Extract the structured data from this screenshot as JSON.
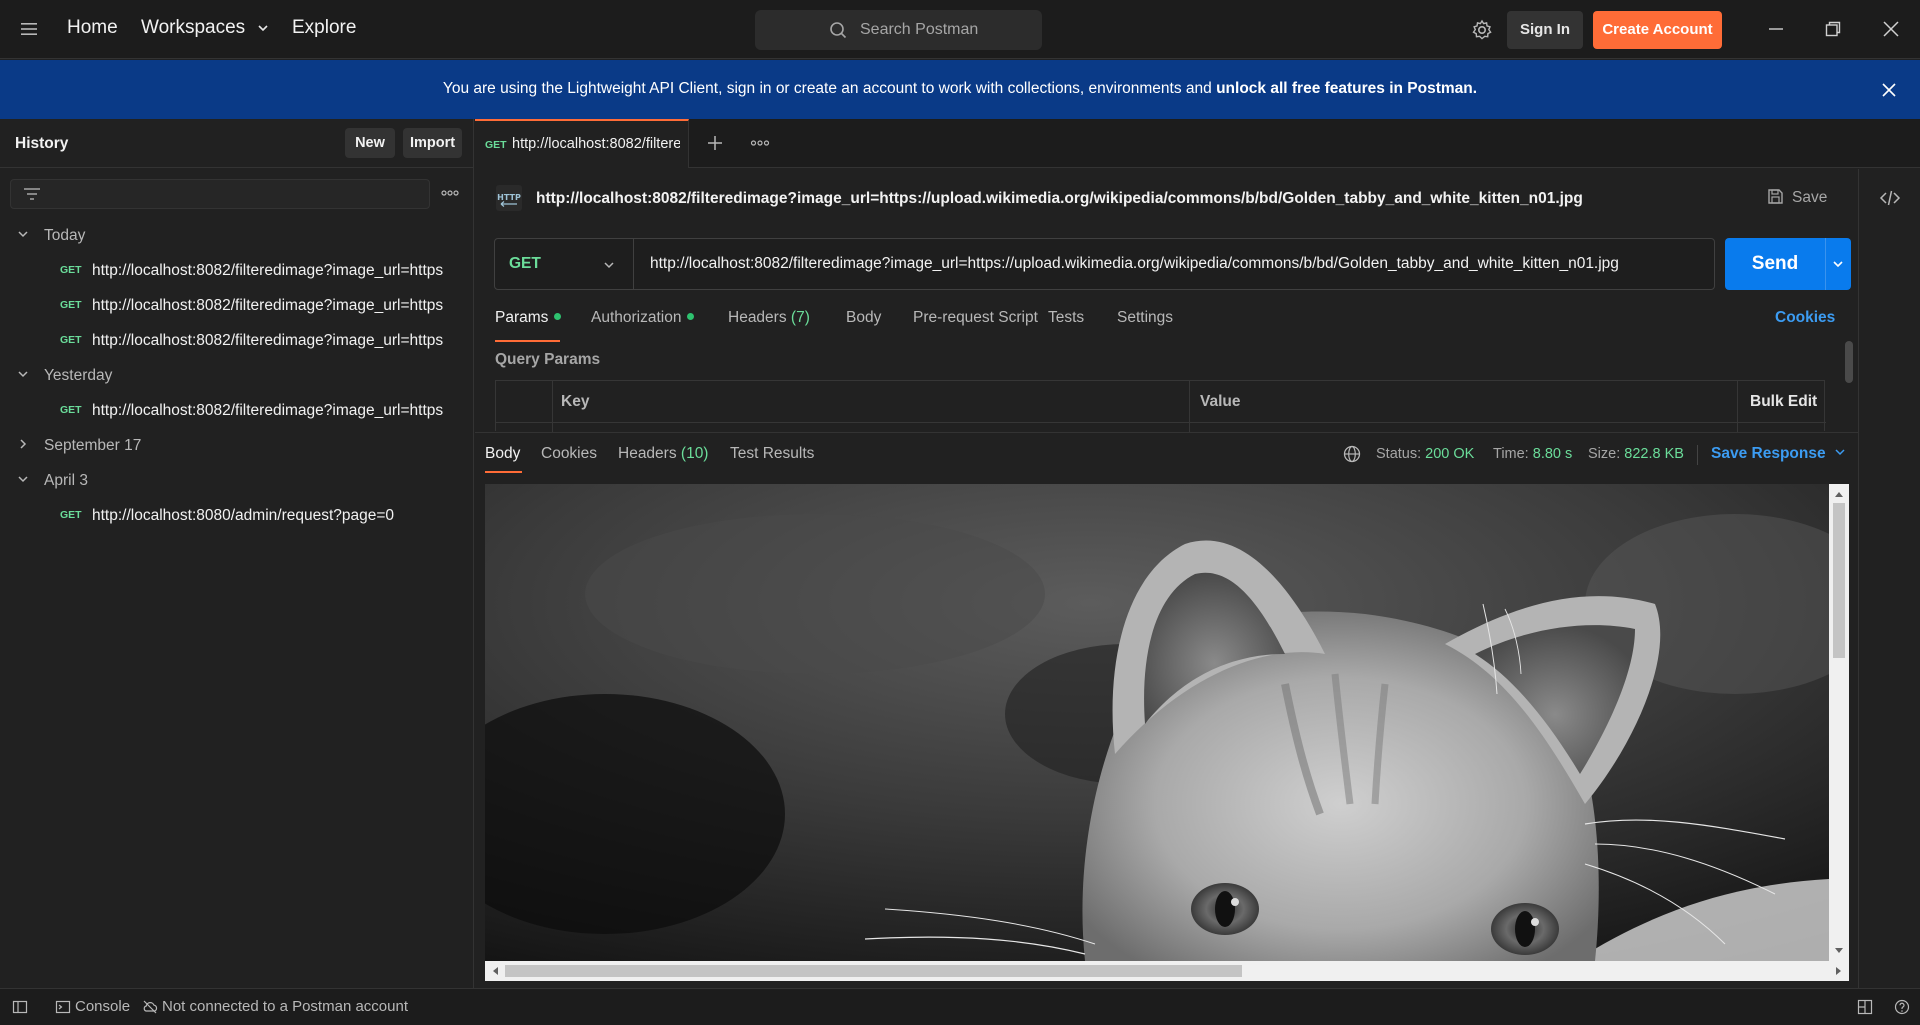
{
  "topbar": {
    "nav": {
      "home": "Home",
      "workspaces": "Workspaces",
      "explore": "Explore"
    },
    "search_placeholder": "Search Postman",
    "sign_in": "Sign In",
    "create_account": "Create Account"
  },
  "banner": {
    "text": "You are using the Lightweight API Client, sign in or create an account to work with collections, environments and ",
    "bold": "unlock all free features in Postman."
  },
  "sidebar": {
    "title": "History",
    "new_label": "New",
    "import_label": "Import",
    "groups": [
      {
        "label": "Today",
        "expanded": true,
        "items": [
          {
            "method": "GET",
            "url": "http://localhost:8082/filteredimage?image_url=https"
          },
          {
            "method": "GET",
            "url": "http://localhost:8082/filteredimage?image_url=https"
          },
          {
            "method": "GET",
            "url": "http://localhost:8082/filteredimage?image_url=https"
          }
        ]
      },
      {
        "label": "Yesterday",
        "expanded": true,
        "items": [
          {
            "method": "GET",
            "url": "http://localhost:8082/filteredimage?image_url=https"
          }
        ]
      },
      {
        "label": "September 17",
        "expanded": false,
        "items": []
      },
      {
        "label": "April 3",
        "expanded": true,
        "items": [
          {
            "method": "GET",
            "url": "http://localhost:8080/admin/request?page=0"
          }
        ]
      }
    ]
  },
  "tab": {
    "method": "GET",
    "url": "http://localhost:8082/filteredimage?image_url=https"
  },
  "request": {
    "title": "http://localhost:8082/filteredimage?image_url=https://upload.wikimedia.org/wikipedia/commons/b/bd/Golden_tabby_and_white_kitten_n01.jpg",
    "save_label": "Save",
    "method": "GET",
    "url": "http://localhost:8082/filteredimage?image_url=https://upload.wikimedia.org/wikipedia/commons/b/bd/Golden_tabby_and_white_kitten_n01.jpg",
    "send_label": "Send",
    "tabs": {
      "params": "Params",
      "authorization": "Authorization",
      "headers": "Headers",
      "headers_count": "(7)",
      "body": "Body",
      "prerequest": "Pre-request Script",
      "tests": "Tests",
      "settings": "Settings"
    },
    "cookies_label": "Cookies",
    "query_params": {
      "title": "Query Params",
      "key_header": "Key",
      "value_header": "Value",
      "bulk_edit": "Bulk Edit"
    }
  },
  "response": {
    "tabs": {
      "body": "Body",
      "cookies": "Cookies",
      "headers": "Headers",
      "headers_count": "(10)",
      "test_results": "Test Results"
    },
    "status_label": "Status:",
    "status_value": "200 OK",
    "time_label": "Time:",
    "time_value": "8.80 s",
    "size_label": "Size:",
    "size_value": "822.8 KB",
    "save_response": "Save Response"
  },
  "statusbar": {
    "console": "Console",
    "connection": "Not connected to a Postman account"
  },
  "colors": {
    "accent": "#ff6c37",
    "send_blue": "#097bed",
    "method_get": "#6bdd9a",
    "banner_bg": "#0a3a87"
  }
}
